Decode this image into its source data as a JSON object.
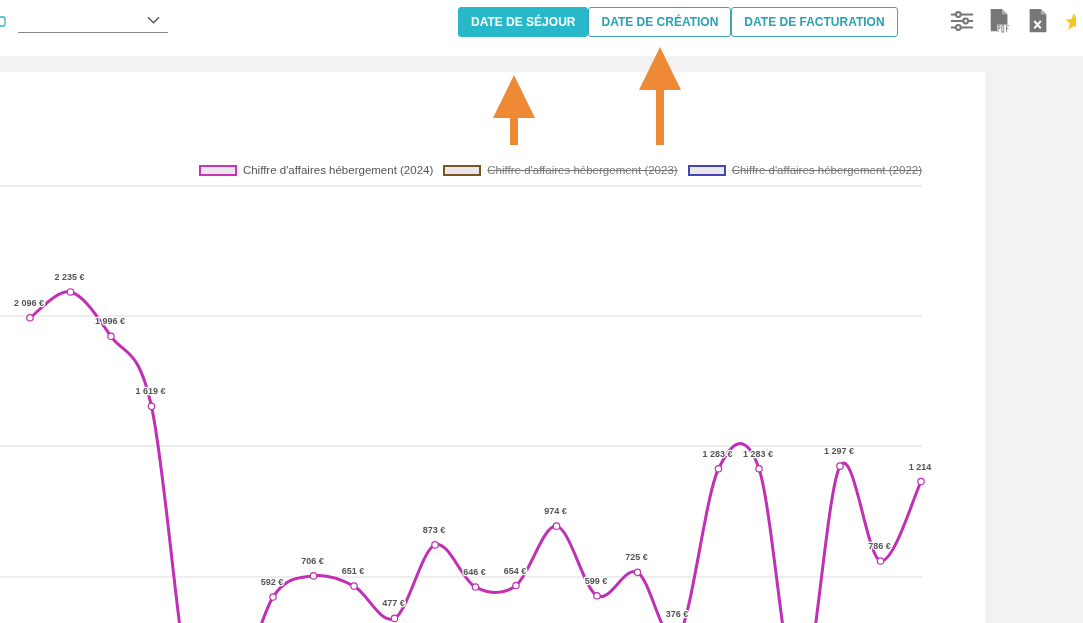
{
  "toolbar": {
    "date_tabs": [
      {
        "label": "DATE DE SÉJOUR",
        "selected": true
      },
      {
        "label": "DATE DE CRÉATION",
        "selected": false
      },
      {
        "label": "DATE DE FACTURATION",
        "selected": false
      }
    ]
  },
  "legend": [
    {
      "label": "Chiffre d'affaires hébergement (2024)",
      "color": "#cc33bb",
      "hidden": false
    },
    {
      "label": "Chiffre d'affaires hébergement (2023)",
      "color": "#7a5522",
      "hidden": true
    },
    {
      "label": "Chiffre d'affaires hébergement (2022)",
      "color": "#4444bb",
      "hidden": true
    }
  ],
  "chart_data": {
    "type": "line",
    "series": [
      {
        "color": "#c02fb4",
        "marker": "circle",
        "values": [
          2096,
          2235,
          1996,
          1619,
          null,
          null,
          592,
          706,
          651,
          477,
          873,
          646,
          654,
          974,
          599,
          725,
          376,
          1283,
          1283,
          null,
          1297,
          786,
          1214
        ],
        "value_labels": [
          "2 096 €",
          "2 235 €",
          "1 996 €",
          "1 619 €",
          null,
          null,
          "592 €",
          "706 €",
          "651 €",
          "477 €",
          "873 €",
          "646 €",
          "654 €",
          "974 €",
          "599 €",
          "725 €",
          "376 €",
          "1 283 €",
          "1 283 €",
          null,
          "1 297 €",
          "786 €",
          "1 214"
        ]
      }
    ]
  },
  "annotations": [
    {
      "kind": "arrow"
    },
    {
      "kind": "arrow"
    }
  ]
}
